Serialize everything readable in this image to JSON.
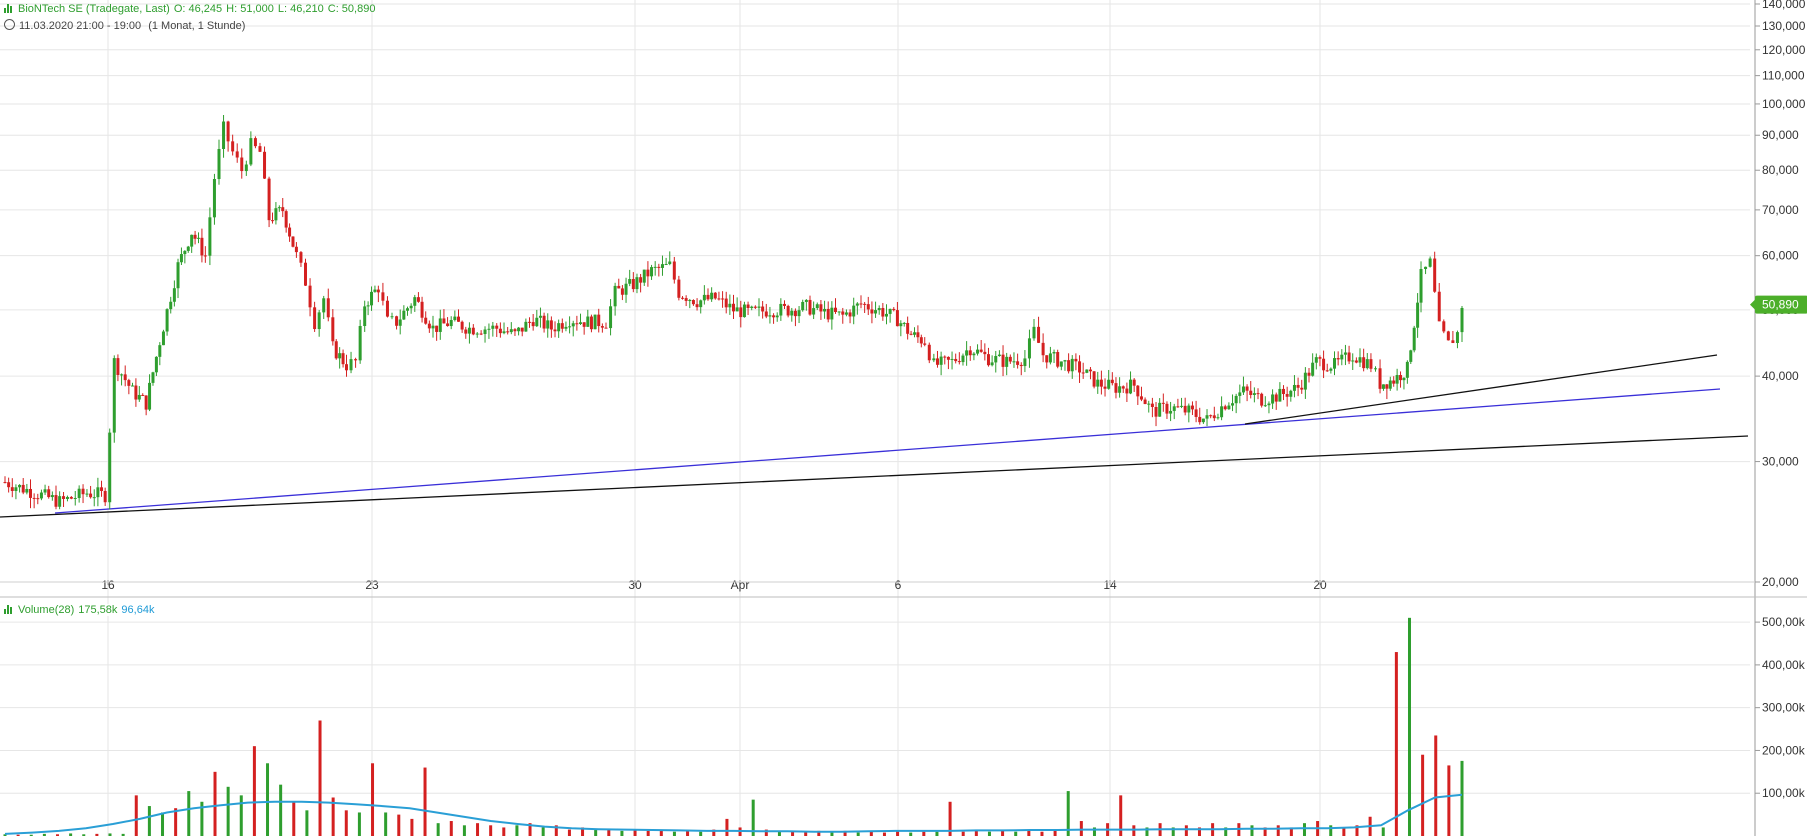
{
  "header": {
    "title": "BioNTech SE (Tradegate, Last)",
    "open": "O: 46,245",
    "high": "H: 51,000",
    "low": "L: 46,210",
    "close": "C: 50,890",
    "range": "11.03.2020 21:00 - 19:00",
    "interval": "(1 Monat, 1 Stunde)",
    "clock_icon": "clock-icon"
  },
  "volume_header": {
    "label": "Volume(28)",
    "volume_value": "175,58k",
    "ma_value": "96,64k",
    "icon": "volume-bars-icon"
  },
  "last_price": "50,890",
  "colors": {
    "up": "#2e9e2e",
    "down": "#d42020",
    "volume_ma": "#2a9fd6",
    "trend_blue": "#3a2fd8",
    "trend_black": "#111111",
    "price_tag": "#4caf2a",
    "grid": "#e6e6e6"
  },
  "chart_data": [
    {
      "type": "candlestick",
      "title": "BioNTech SE (Tradegate, Last)",
      "y_scale": "log",
      "ylim": [
        20,
        140
      ],
      "y_ticks": [
        20,
        30,
        40,
        50,
        60,
        70,
        80,
        90,
        100,
        110,
        120,
        130,
        140
      ],
      "y_tick_labels": [
        "20,000",
        "30,000",
        "40,000",
        "50,000",
        "60,000",
        "70,000",
        "80,000",
        "90,000",
        "100,000",
        "110,000",
        "120,000",
        "130,000",
        "140,000"
      ],
      "x_tick_labels": [
        "16",
        "23",
        "30",
        "Apr",
        "6",
        "14",
        "20"
      ],
      "series": [
        {
          "name": "BioNTech SE",
          "points": [
            {
              "t": 0,
              "v": 28.0
            },
            {
              "t": 4,
              "v": 26.8
            },
            {
              "t": 6,
              "v": 26.2
            },
            {
              "t": 9,
              "v": 27.0
            },
            {
              "t": 11,
              "v": 26.8
            },
            {
              "t": 12,
              "v": 42.0
            },
            {
              "t": 14,
              "v": 38.0
            },
            {
              "t": 15.5,
              "v": 36.5
            },
            {
              "t": 17,
              "v": 45.0
            },
            {
              "t": 19,
              "v": 58.0
            },
            {
              "t": 20.5,
              "v": 65.0
            },
            {
              "t": 22,
              "v": 60.0
            },
            {
              "t": 23,
              "v": 78.0
            },
            {
              "t": 24,
              "v": 92.0
            },
            {
              "t": 25,
              "v": 85.0
            },
            {
              "t": 26,
              "v": 80.0
            },
            {
              "t": 27,
              "v": 87.0
            },
            {
              "t": 28,
              "v": 85.0
            },
            {
              "t": 29,
              "v": 68.0
            },
            {
              "t": 30.5,
              "v": 70.0
            },
            {
              "t": 32,
              "v": 60.0
            },
            {
              "t": 33,
              "v": 55.0
            },
            {
              "t": 34,
              "v": 48.0
            },
            {
              "t": 35,
              "v": 52.0
            },
            {
              "t": 36,
              "v": 44.0
            },
            {
              "t": 37.5,
              "v": 41.5
            },
            {
              "t": 38.5,
              "v": 42.0
            },
            {
              "t": 39.5,
              "v": 51.0
            },
            {
              "t": 41,
              "v": 54.0
            },
            {
              "t": 42,
              "v": 48.0
            },
            {
              "t": 43,
              "v": 48.0
            },
            {
              "t": 45,
              "v": 52.0
            },
            {
              "t": 47,
              "v": 47.0
            },
            {
              "t": 49,
              "v": 48.0
            },
            {
              "t": 51,
              "v": 47.0
            },
            {
              "t": 54,
              "v": 47.0
            },
            {
              "t": 56,
              "v": 46.0
            },
            {
              "t": 58,
              "v": 48.5
            },
            {
              "t": 60,
              "v": 47.0
            },
            {
              "t": 62,
              "v": 48.5
            },
            {
              "t": 64,
              "v": 48.0
            },
            {
              "t": 66,
              "v": 48.0
            },
            {
              "t": 67,
              "v": 53.0
            },
            {
              "t": 69,
              "v": 54.5
            },
            {
              "t": 71,
              "v": 57.0
            },
            {
              "t": 73,
              "v": 58.0
            },
            {
              "t": 74,
              "v": 53.0
            },
            {
              "t": 76,
              "v": 51.5
            },
            {
              "t": 78,
              "v": 52.0
            },
            {
              "t": 80,
              "v": 50.0
            },
            {
              "t": 82,
              "v": 49.5
            },
            {
              "t": 84,
              "v": 50.0
            },
            {
              "t": 86,
              "v": 50.0
            },
            {
              "t": 88,
              "v": 50.5
            },
            {
              "t": 90,
              "v": 49.5
            },
            {
              "t": 92,
              "v": 49.0
            },
            {
              "t": 94,
              "v": 51.0
            },
            {
              "t": 96,
              "v": 50.0
            },
            {
              "t": 98,
              "v": 48.5
            },
            {
              "t": 99.5,
              "v": 46.0
            },
            {
              "t": 101,
              "v": 45.0
            },
            {
              "t": 102,
              "v": 41.5
            },
            {
              "t": 104,
              "v": 42.0
            },
            {
              "t": 106,
              "v": 44.0
            },
            {
              "t": 108,
              "v": 42.5
            },
            {
              "t": 110,
              "v": 42.0
            },
            {
              "t": 112,
              "v": 42.5
            },
            {
              "t": 113,
              "v": 46.5
            },
            {
              "t": 114,
              "v": 43.0
            },
            {
              "t": 116,
              "v": 42.0
            },
            {
              "t": 118,
              "v": 41.0
            },
            {
              "t": 120,
              "v": 39.0
            },
            {
              "t": 122,
              "v": 38.5
            },
            {
              "t": 124,
              "v": 38.8
            },
            {
              "t": 126,
              "v": 35.5
            },
            {
              "t": 128,
              "v": 36.0
            },
            {
              "t": 130,
              "v": 35.5
            },
            {
              "t": 132,
              "v": 34.5
            },
            {
              "t": 134,
              "v": 36.5
            },
            {
              "t": 136,
              "v": 38.0
            },
            {
              "t": 138,
              "v": 37.0
            },
            {
              "t": 140,
              "v": 37.5
            },
            {
              "t": 142,
              "v": 38.5
            },
            {
              "t": 144,
              "v": 42.0
            },
            {
              "t": 146,
              "v": 41.5
            },
            {
              "t": 148,
              "v": 43.0
            },
            {
              "t": 150,
              "v": 41.5
            },
            {
              "t": 151,
              "v": 39.0
            },
            {
              "t": 152.5,
              "v": 39.5
            },
            {
              "t": 154,
              "v": 41.0
            },
            {
              "t": 155.5,
              "v": 56.0
            },
            {
              "t": 156.5,
              "v": 58.5
            },
            {
              "t": 157.5,
              "v": 47.0
            },
            {
              "t": 158.5,
              "v": 44.5
            },
            {
              "t": 159.5,
              "v": 46.2
            },
            {
              "t": 160,
              "v": 50.9
            }
          ]
        }
      ],
      "last_value": 50.89
    },
    {
      "type": "bar",
      "title": "Volume(28)",
      "ylim": [
        0,
        540000
      ],
      "y_ticks": [
        100000,
        200000,
        300000,
        400000,
        500000
      ],
      "y_tick_labels": [
        "100,00k",
        "200,00k",
        "300,00k",
        "400,00k",
        "500,00k"
      ],
      "series": [
        {
          "name": "Volume",
          "values": [
            4000,
            3000,
            3000,
            5000,
            4000,
            6000,
            4000,
            5000,
            6000,
            5000,
            95000,
            70000,
            55000,
            65000,
            105000,
            80000,
            150000,
            115000,
            95000,
            210000,
            170000,
            120000,
            80000,
            60000,
            270000,
            90000,
            60000,
            55000,
            170000,
            55000,
            50000,
            40000,
            160000,
            30000,
            35000,
            25000,
            30000,
            25000,
            20000,
            25000,
            30000,
            20000,
            25000,
            15000,
            20000,
            15000,
            15000,
            12000,
            15000,
            12000,
            12000,
            10000,
            12000,
            10000,
            15000,
            40000,
            20000,
            85000,
            15000,
            10000,
            12000,
            10000,
            12000,
            10000,
            12000,
            8000,
            10000,
            8000,
            12000,
            8000,
            10000,
            10000,
            80000,
            10000,
            12000,
            10000,
            12000,
            10000,
            15000,
            10000,
            12000,
            105000,
            35000,
            20000,
            30000,
            95000,
            25000,
            20000,
            30000,
            20000,
            25000,
            20000,
            30000,
            20000,
            30000,
            25000,
            20000,
            25000,
            20000,
            30000,
            35000,
            25000,
            20000,
            25000,
            45000,
            20000,
            430000,
            510000,
            190000,
            235000,
            165000,
            175580
          ]
        },
        {
          "name": "Volume MA(28)",
          "values": [
            5000,
            8000,
            12000,
            18000,
            28000,
            40000,
            55000,
            65000,
            72000,
            78000,
            80000,
            80000,
            78000,
            74000,
            70000,
            65000,
            55000,
            45000,
            35000,
            28000,
            22000,
            18000,
            16000,
            15000,
            14000,
            13000,
            12000,
            12000,
            11000,
            11000,
            10000,
            10000,
            11000,
            12000,
            12000,
            12000,
            13000,
            13000,
            14000,
            14000,
            15000,
            15000,
            15000,
            16000,
            16000,
            16000,
            17000,
            17000,
            18000,
            18000,
            20000,
            25000,
            60000,
            90000,
            96640
          ]
        }
      ]
    }
  ]
}
